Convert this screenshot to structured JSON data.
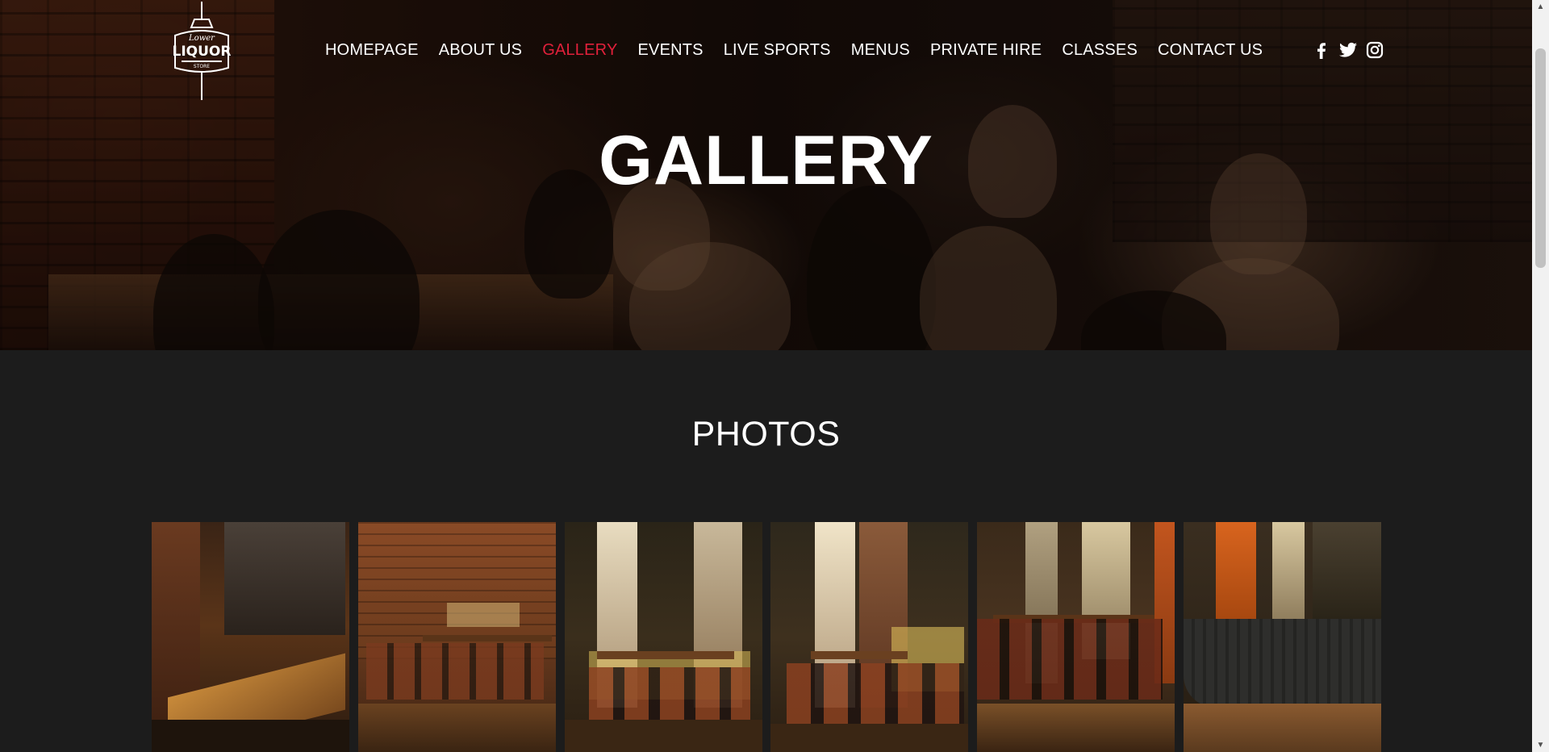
{
  "logo": {
    "alt": "Lower Liquor Store logo"
  },
  "nav": {
    "items": [
      {
        "label": "HOMEPAGE",
        "active": false
      },
      {
        "label": "ABOUT US",
        "active": false
      },
      {
        "label": "GALLERY",
        "active": true
      },
      {
        "label": "EVENTS",
        "active": false
      },
      {
        "label": "LIVE SPORTS",
        "active": false
      },
      {
        "label": "MENUS",
        "active": false
      },
      {
        "label": "PRIVATE HIRE",
        "active": false
      },
      {
        "label": "CLASSES",
        "active": false
      },
      {
        "label": "CONTACT US",
        "active": false
      }
    ],
    "active_color": "#e0203a"
  },
  "social": [
    "facebook-icon",
    "twitter-icon",
    "instagram-icon"
  ],
  "hero": {
    "title": "GALLERY"
  },
  "photos": {
    "title": "PHOTOS",
    "items": [
      {
        "name": "bar-counter-photo"
      },
      {
        "name": "brick-wall-seating-photo"
      },
      {
        "name": "window-table-photo-1"
      },
      {
        "name": "window-table-photo-2"
      },
      {
        "name": "high-tables-photo"
      },
      {
        "name": "booth-seating-photo"
      }
    ]
  },
  "colors": {
    "background": "#1c1c1c",
    "text": "#ffffff"
  }
}
